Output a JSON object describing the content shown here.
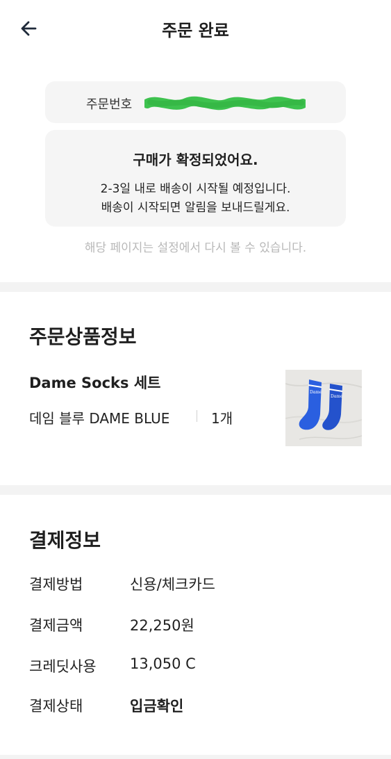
{
  "header": {
    "title": "주문 완료",
    "back_icon": "arrow-left-icon"
  },
  "order_number": {
    "label": "주문번호"
  },
  "confirmation": {
    "title": "구매가 확정되었어요.",
    "line1": "2-3일 내로 배송이 시작될 예정입니다.",
    "line2": "배송이 시작되면 알림을 보내드릴게요."
  },
  "hint": "해당 페이지는 설정에서 다시 볼 수 있습니다.",
  "product_section": {
    "title": "주문상품정보",
    "product": {
      "name": "Dame Socks 세트",
      "option": "데임 블루 DAME BLUE",
      "quantity": "1개"
    }
  },
  "payment_section": {
    "title": "결제정보",
    "rows": [
      {
        "label": "결제방법",
        "value": "신용/체크카드"
      },
      {
        "label": "결제금액",
        "value": "22,250원"
      },
      {
        "label": "크레딧사용",
        "value": "13,050 C"
      },
      {
        "label": "결제상태",
        "value": "입금확인"
      }
    ]
  },
  "colors": {
    "redaction": "#3ec24f",
    "box_bg": "#f5f5f5",
    "hint_text": "#b8b8b8",
    "sock_blue": "#2a5fe0"
  }
}
